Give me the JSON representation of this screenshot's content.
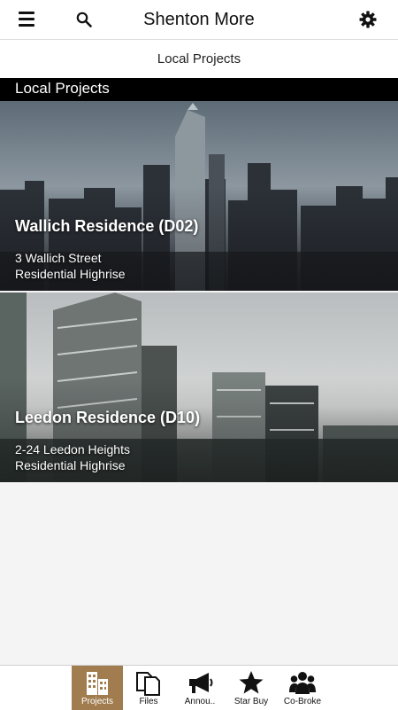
{
  "header": {
    "title": "Shenton More"
  },
  "subheader": {
    "label": "Local Projects"
  },
  "section": {
    "title": "Local Projects"
  },
  "projects": [
    {
      "name": "Wallich Residence (D02)",
      "address": "3 Wallich Street",
      "type": "Residential Highrise"
    },
    {
      "name": "Leedon Residence (D10)",
      "address": "2-24 Leedon Heights",
      "type": "Residential Highrise"
    }
  ],
  "nav": [
    {
      "label": "Projects",
      "icon": "buildings-icon",
      "active": true
    },
    {
      "label": "Files",
      "icon": "files-icon",
      "active": false
    },
    {
      "label": "Annou..",
      "icon": "megaphone-icon",
      "active": false
    },
    {
      "label": "Star Buy",
      "icon": "star-icon",
      "active": false
    },
    {
      "label": "Co-Broke",
      "icon": "group-icon",
      "active": false
    }
  ],
  "colors": {
    "accent": "#a07c4f",
    "section_bar": "#000000"
  }
}
